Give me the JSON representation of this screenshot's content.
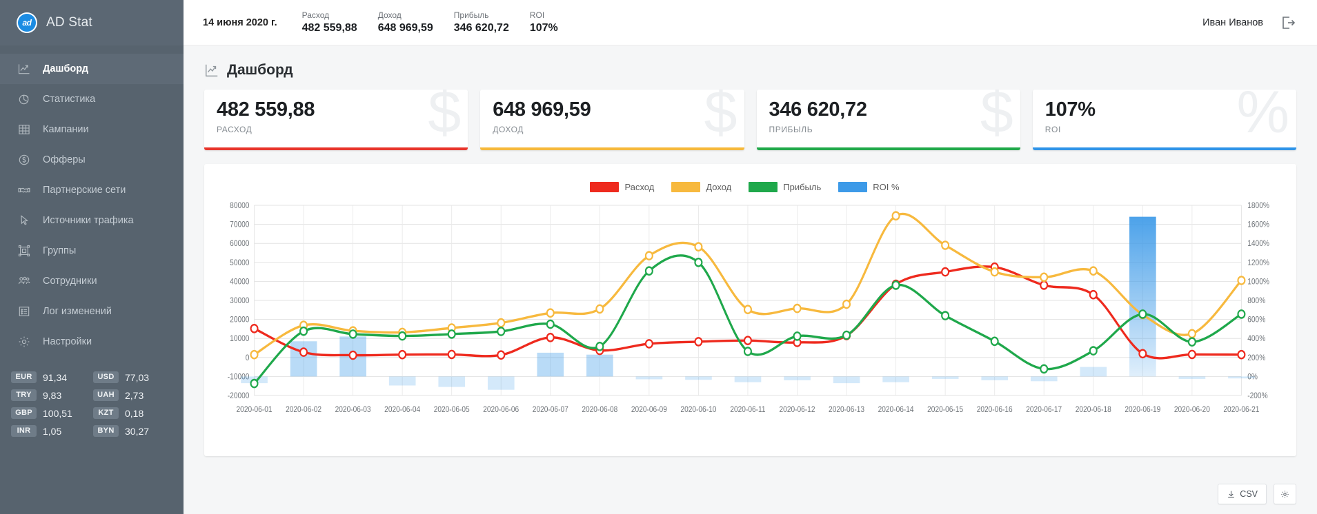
{
  "brand": {
    "logo_text": "ad",
    "title": "AD Stat",
    "logo_color": "#1b8ce3"
  },
  "sidebar": {
    "items": [
      {
        "label": "Дашборд",
        "icon": "line-chart-icon",
        "active": true
      },
      {
        "label": "Статистика",
        "icon": "pie-chart-icon",
        "active": false
      },
      {
        "label": "Кампании",
        "icon": "table-icon",
        "active": false
      },
      {
        "label": "Офферы",
        "icon": "dollar-circle-icon",
        "active": false
      },
      {
        "label": "Партнерские сети",
        "icon": "handshake-icon",
        "active": false
      },
      {
        "label": "Источники трафика",
        "icon": "cursor-icon",
        "active": false
      },
      {
        "label": "Группы",
        "icon": "group-box-icon",
        "active": false
      },
      {
        "label": "Сотрудники",
        "icon": "users-icon",
        "active": false
      },
      {
        "label": "Лог изменений",
        "icon": "list-icon",
        "active": false
      },
      {
        "label": "Настройки",
        "icon": "gear-icon",
        "active": false
      }
    ],
    "rates": [
      {
        "code": "EUR",
        "value": "91,34"
      },
      {
        "code": "USD",
        "value": "77,03"
      },
      {
        "code": "TRY",
        "value": "9,83"
      },
      {
        "code": "UAH",
        "value": "2,73"
      },
      {
        "code": "GBP",
        "value": "100,51"
      },
      {
        "code": "KZT",
        "value": "0,18"
      },
      {
        "code": "INR",
        "value": "1,05"
      },
      {
        "code": "BYN",
        "value": "30,27"
      }
    ]
  },
  "topbar": {
    "date": "14 июня 2020 г.",
    "stats": [
      {
        "label": "Расход",
        "value": "482 559,88"
      },
      {
        "label": "Доход",
        "value": "648 969,59"
      },
      {
        "label": "Прибыль",
        "value": "346 620,72"
      },
      {
        "label": "ROI",
        "value": "107%"
      }
    ],
    "user": "Иван Иванов",
    "logout_icon": "logout-icon"
  },
  "page": {
    "title": "Дашборд",
    "icon": "line-chart-icon"
  },
  "kpis": [
    {
      "value": "482 559,88",
      "label": "РАСХОД",
      "watermark": "$",
      "color": "#e8352b"
    },
    {
      "value": "648 969,59",
      "label": "ДОХОД",
      "watermark": "$",
      "color": "#f6b93b"
    },
    {
      "value": "346 620,72",
      "label": "ПРИБЫЛЬ",
      "watermark": "$",
      "color": "#21a94a"
    },
    {
      "value": "107%",
      "label": "ROI",
      "watermark": "%",
      "color": "#2f94e8"
    }
  ],
  "footer_buttons": [
    {
      "label": "CSV",
      "icon": "download-icon"
    },
    {
      "label": "",
      "icon": "gear-icon"
    }
  ],
  "chart_data": {
    "type": "line",
    "title": "",
    "xlabel": "",
    "ylabel": "",
    "grid": true,
    "legend_position": "top-center",
    "categories": [
      "2020-06-01",
      "2020-06-02",
      "2020-06-03",
      "2020-06-04",
      "2020-06-05",
      "2020-06-06",
      "2020-06-07",
      "2020-06-08",
      "2020-06-09",
      "2020-06-10",
      "2020-06-11",
      "2020-06-12",
      "2020-06-13",
      "2020-06-14",
      "2020-06-15",
      "2020-06-16",
      "2020-06-17",
      "2020-06-18",
      "2020-06-19",
      "2020-06-20",
      "2020-06-21"
    ],
    "left_axis": {
      "label": "",
      "ylim": [
        -20000,
        80000
      ],
      "ticks": [
        -20000,
        -10000,
        0,
        10000,
        20000,
        30000,
        40000,
        50000,
        60000,
        70000,
        80000
      ],
      "tick_labels": [
        "-20000",
        "-10000",
        "0",
        "10000",
        "20000",
        "30000",
        "40000",
        "50000",
        "60000",
        "70000",
        "80000"
      ]
    },
    "right_axis": {
      "label": "",
      "ylim": [
        -200,
        1800
      ],
      "ticks": [
        -200,
        0,
        200,
        400,
        600,
        800,
        1000,
        1200,
        1400,
        1600,
        1800
      ],
      "tick_labels": [
        "-200%",
        "0%",
        "200%",
        "400%",
        "600%",
        "800%",
        "1000%",
        "1200%",
        "1400%",
        "1600%",
        "1800%"
      ]
    },
    "series": [
      {
        "name": "Расход",
        "type": "line",
        "color": "#ee2a1e",
        "axis": "left",
        "values": [
          15200,
          2800,
          1200,
          1500,
          1600,
          1300,
          10500,
          3700,
          7200,
          8300,
          8900,
          7900,
          11500,
          38500,
          45000,
          47500,
          38000,
          33000,
          2000,
          1600,
          1500
        ]
      },
      {
        "name": "Доход",
        "type": "line",
        "color": "#f7b93e",
        "axis": "left",
        "values": [
          1500,
          16900,
          14000,
          13200,
          15500,
          18200,
          23400,
          25500,
          53500,
          58200,
          25200,
          25800,
          28000,
          74500,
          59000,
          45000,
          42200,
          45500,
          22500,
          12500,
          40500
        ]
      },
      {
        "name": "Прибыль",
        "type": "line",
        "color": "#1fa84b",
        "axis": "left",
        "values": [
          -13700,
          13800,
          12300,
          11300,
          12300,
          13700,
          17500,
          5800,
          45500,
          50000,
          3200,
          11200,
          11700,
          38000,
          22000,
          8500,
          -6000,
          3500,
          22800,
          8200,
          22800
        ]
      },
      {
        "name": "ROI %",
        "type": "bar",
        "color": "#3d9ae8",
        "axis": "right",
        "values": [
          -70,
          370,
          420,
          -95,
          -110,
          -140,
          250,
          230,
          -30,
          -35,
          -60,
          -40,
          -70,
          -60,
          -25,
          -40,
          -50,
          100,
          1680,
          -25,
          -20
        ]
      }
    ]
  }
}
